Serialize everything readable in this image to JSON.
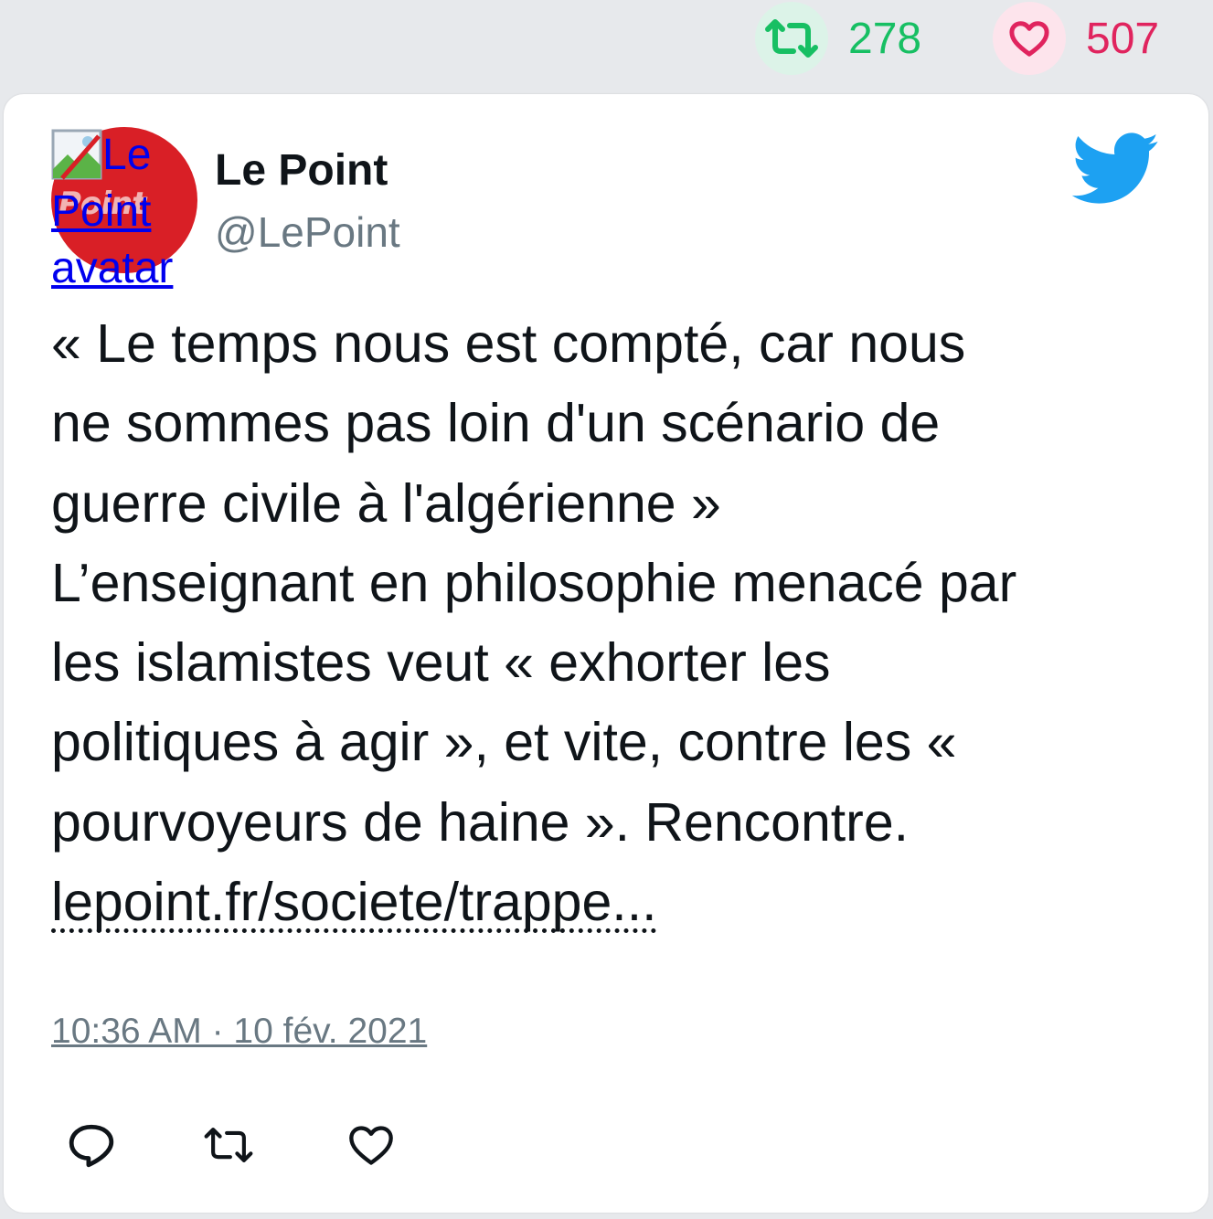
{
  "stats": {
    "retweets": "278",
    "likes": "507",
    "retweet_color": "#17bf63",
    "like_color": "#e0245e"
  },
  "author": {
    "name": "Le Point",
    "handle": "@LePoint",
    "avatar_alt": "Le Point avatar",
    "avatar_alt_lines": [
      "Le",
      "Point",
      "avatar"
    ],
    "avatar_color": "#d91f26"
  },
  "tweet": {
    "lines": [
      "« Le temps nous est compté, car nous",
      "ne sommes pas loin d'un scénario de",
      "guerre civile à l'algérienne »",
      "L’enseignant en philosophie menacé par",
      "les islamistes veut « exhorter les",
      "politiques à agir », et vite, contre les «",
      "pourvoyeurs de haine ». Rencontre."
    ],
    "link": "lepoint.fr/societe/trappe...",
    "timestamp": "10:36 AM · 10 fév. 2021"
  },
  "icons": {
    "retweet_stat": "retweet-icon",
    "like_stat": "heart-icon",
    "brand": "twitter-bird-icon",
    "reply": "reply-icon",
    "retweet": "retweet-icon",
    "like": "heart-icon"
  },
  "brand_color": "#1da1f2"
}
